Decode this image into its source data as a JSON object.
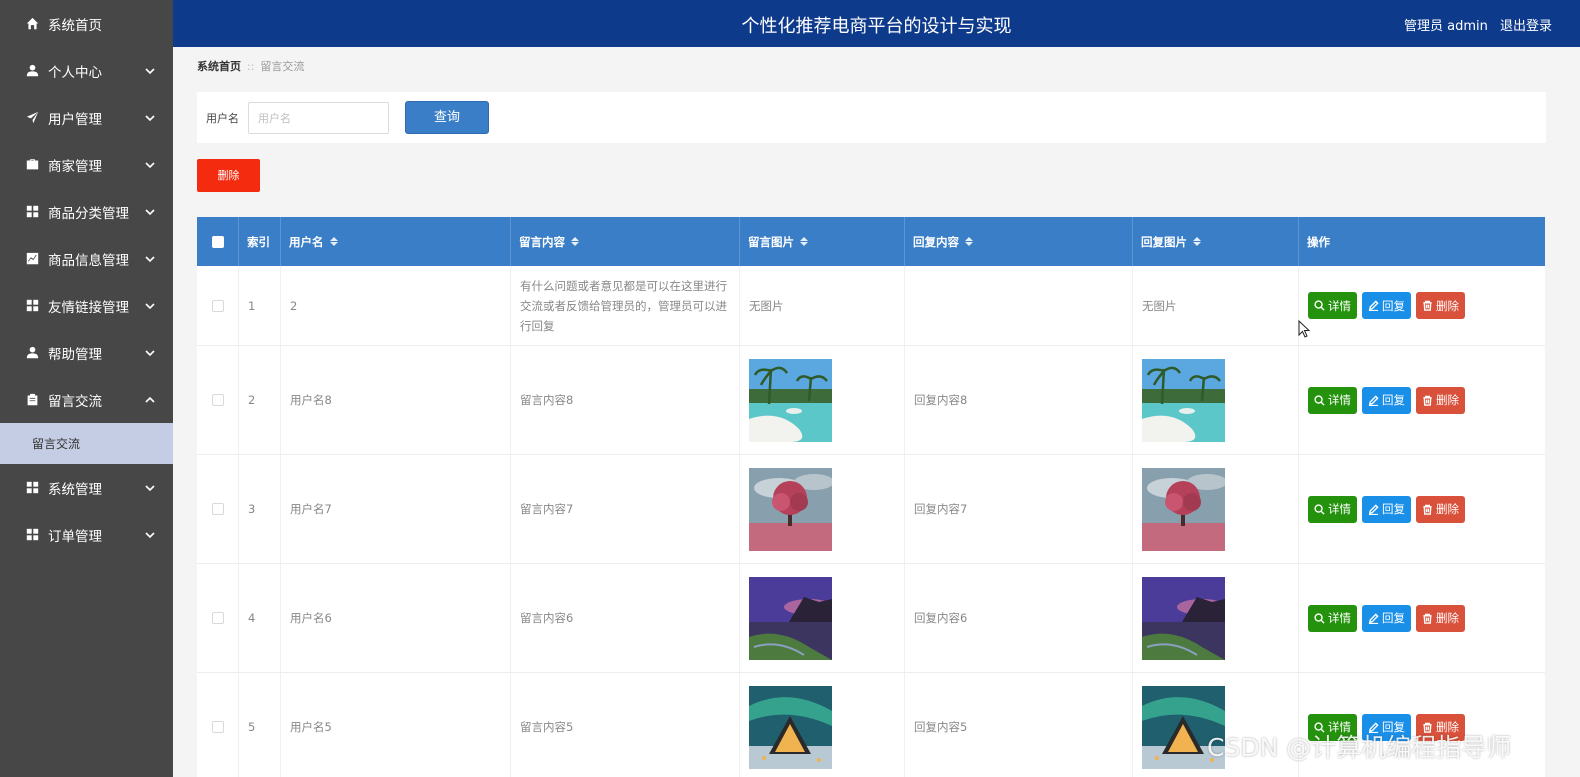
{
  "header": {
    "title": "个性化推荐电商平台的设计与实现",
    "user_label": "管理员 admin",
    "logout_label": "退出登录"
  },
  "sidebar": {
    "items": [
      {
        "label": "系统首页",
        "icon": "home-icon"
      },
      {
        "label": "个人中心",
        "icon": "user-icon"
      },
      {
        "label": "用户管理",
        "icon": "paper-plane-icon"
      },
      {
        "label": "商家管理",
        "icon": "briefcase-icon"
      },
      {
        "label": "商品分类管理",
        "icon": "grid-icon"
      },
      {
        "label": "商品信息管理",
        "icon": "chart-icon"
      },
      {
        "label": "友情链接管理",
        "icon": "grid-icon"
      },
      {
        "label": "帮助管理",
        "icon": "user-icon"
      },
      {
        "label": "留言交流",
        "icon": "clipboard-icon"
      },
      {
        "label": "系统管理",
        "icon": "grid-icon"
      },
      {
        "label": "订单管理",
        "icon": "grid-icon"
      }
    ],
    "active_sub": "留言交流"
  },
  "breadcrumb": {
    "home": "系统首页",
    "separator": "::",
    "current": "留言交流"
  },
  "search": {
    "label": "用户名",
    "placeholder": "用户名",
    "button": "查询"
  },
  "delete_button": "删除",
  "table": {
    "headers": [
      "索引",
      "用户名",
      "留言内容",
      "留言图片",
      "回复内容",
      "回复图片",
      "操作"
    ],
    "action_labels": {
      "detail": "详情",
      "reply": "回复",
      "delete": "删除"
    },
    "no_image": "无图片",
    "rows": [
      {
        "index": "1",
        "username": "2",
        "content": "有什么问题或者意见都是可以在这里进行交流或者反馈给管理员的，管理员可以进行回复",
        "msg_image": "none",
        "reply": "",
        "reply_image": "none"
      },
      {
        "index": "2",
        "username": "用户名8",
        "content": "留言内容8",
        "msg_image": "beach",
        "reply": "回复内容8",
        "reply_image": "beach"
      },
      {
        "index": "3",
        "username": "用户名7",
        "content": "留言内容7",
        "msg_image": "pink-tree",
        "reply": "回复内容7",
        "reply_image": "pink-tree"
      },
      {
        "index": "4",
        "username": "用户名6",
        "content": "留言内容6",
        "msg_image": "purple-coast",
        "reply": "回复内容6",
        "reply_image": "purple-coast"
      },
      {
        "index": "5",
        "username": "用户名5",
        "content": "留言内容5",
        "msg_image": "aurora-cabin",
        "reply": "回复内容5",
        "reply_image": "aurora-cabin"
      }
    ]
  },
  "watermark": "CSDN @计算机编程指导师"
}
